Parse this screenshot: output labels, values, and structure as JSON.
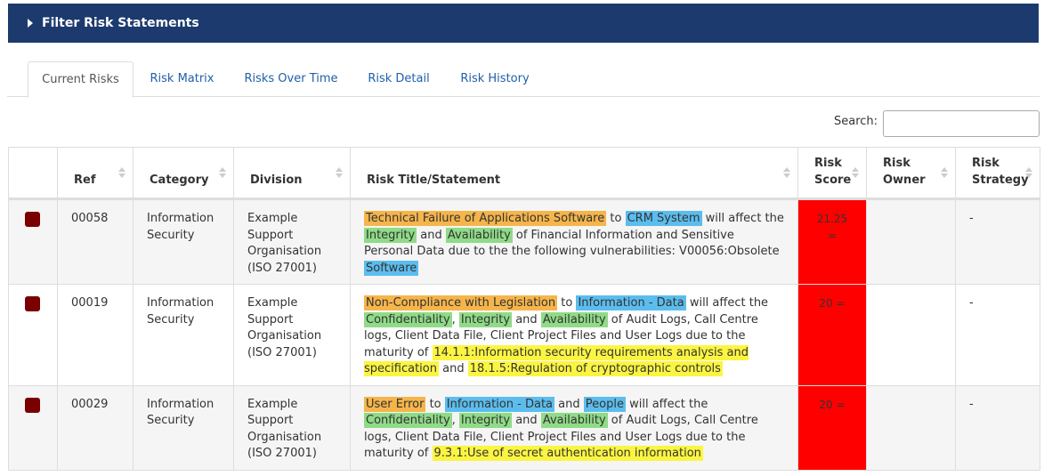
{
  "filter": {
    "title": "Filter Risk Statements"
  },
  "tabs": [
    {
      "label": "Current Risks",
      "active": true
    },
    {
      "label": "Risk Matrix",
      "active": false
    },
    {
      "label": "Risks Over Time",
      "active": false
    },
    {
      "label": "Risk Detail",
      "active": false
    },
    {
      "label": "Risk History",
      "active": false
    }
  ],
  "search": {
    "label": "Search:",
    "value": ""
  },
  "table": {
    "headers": {
      "ref": "Ref",
      "category": "Category",
      "division": "Division",
      "title": "Risk Title/Statement",
      "score": [
        "Risk",
        "Score"
      ],
      "owner": [
        "Risk",
        "Owner"
      ],
      "strategy": [
        "Risk",
        "Strategy"
      ]
    },
    "rows": [
      {
        "ref": "00058",
        "category": [
          "Information",
          "Security"
        ],
        "division": [
          "Example",
          "Support",
          "Organisation",
          "(ISO 27001)"
        ],
        "statement": [
          {
            "text": "Technical Failure of Applications Software",
            "hl": "orange"
          },
          {
            "text": " to "
          },
          {
            "text": "CRM System",
            "hl": "blue"
          },
          {
            "text": " will affect the "
          },
          {
            "text": "Integrity",
            "hl": "green"
          },
          {
            "text": " and "
          },
          {
            "text": "Availability",
            "hl": "green"
          },
          {
            "text": " of Financial Information and Sensitive Personal Data due to the the following vulnerabilities: V00056:Obsolete "
          },
          {
            "text": "Software",
            "hl": "blue"
          }
        ],
        "score": "21.25 =",
        "owner": "",
        "strategy": "-",
        "status_color": "#7a0000"
      },
      {
        "ref": "00019",
        "category": [
          "Information",
          "Security"
        ],
        "division": [
          "Example",
          "Support",
          "Organisation",
          "(ISO 27001)"
        ],
        "statement": [
          {
            "text": "Non-Compliance with Legislation",
            "hl": "orange"
          },
          {
            "text": " to "
          },
          {
            "text": "Information - Data",
            "hl": "blue"
          },
          {
            "text": " will affect the "
          },
          {
            "text": "Confidentiality",
            "hl": "green"
          },
          {
            "text": ", "
          },
          {
            "text": "Integrity",
            "hl": "green"
          },
          {
            "text": " and "
          },
          {
            "text": "Availability",
            "hl": "green"
          },
          {
            "text": " of Audit Logs, Call Centre logs, Client Data File, Client Project Files and User Logs due to the maturity of "
          },
          {
            "text": "14.1.1:Information security requirements analysis and specification",
            "hl": "yellow"
          },
          {
            "text": " and "
          },
          {
            "text": "18.1.5:Regulation of cryptographic controls",
            "hl": "yellow"
          }
        ],
        "score": "20 =",
        "owner": "",
        "strategy": "-",
        "status_color": "#7a0000"
      },
      {
        "ref": "00029",
        "category": [
          "Information",
          "Security"
        ],
        "division": [
          "Example",
          "Support",
          "Organisation",
          "(ISO 27001)"
        ],
        "statement": [
          {
            "text": "User Error",
            "hl": "orange"
          },
          {
            "text": " to "
          },
          {
            "text": "Information - Data",
            "hl": "blue"
          },
          {
            "text": " and "
          },
          {
            "text": "People",
            "hl": "blue"
          },
          {
            "text": " will affect the "
          },
          {
            "text": "Confidentiality",
            "hl": "green"
          },
          {
            "text": ", "
          },
          {
            "text": "Integrity",
            "hl": "green"
          },
          {
            "text": " and "
          },
          {
            "text": "Availability",
            "hl": "green"
          },
          {
            "text": " of Audit Logs, Call Centre logs, Client Data File, Client Project Files and User Logs due to the maturity of "
          },
          {
            "text": "9.3.1:Use of secret authentication information",
            "hl": "yellow"
          }
        ],
        "score": "20 =",
        "owner": "",
        "strategy": "-",
        "status_color": "#7a0000"
      }
    ]
  },
  "colors": {
    "header_bar": "#1c3a6e",
    "link": "#1f5fa8",
    "score_high": "#ff0000",
    "highlight_threat": "#f5b54b",
    "highlight_asset": "#5bbdee",
    "highlight_impact": "#8fdb87",
    "highlight_control": "#fbf542"
  }
}
